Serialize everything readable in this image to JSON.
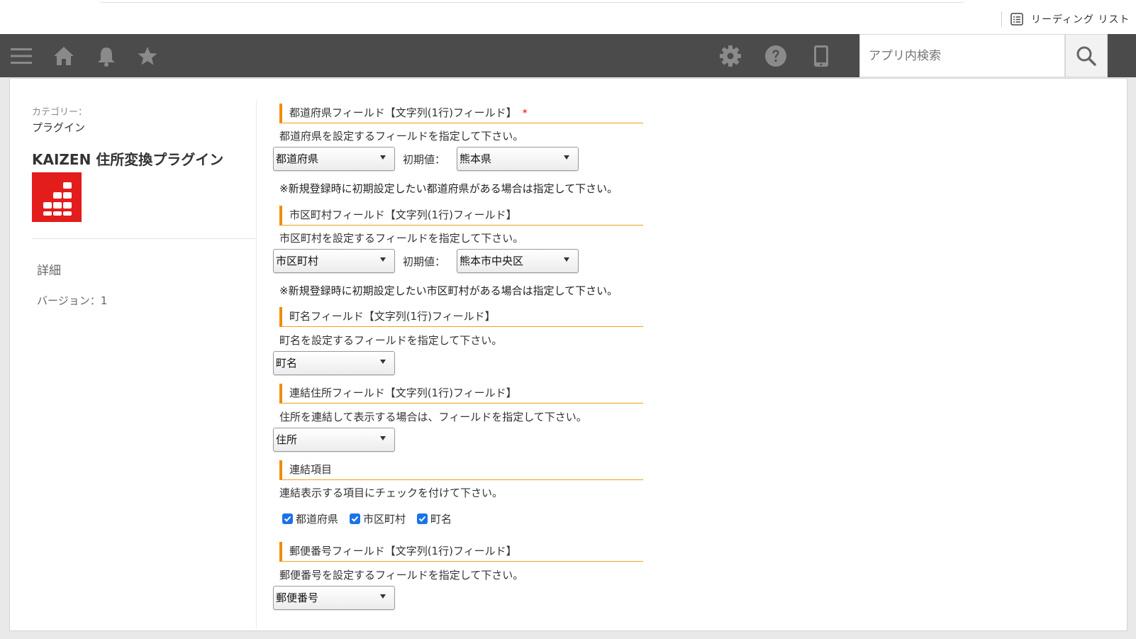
{
  "browser": {
    "reading_list_label": "リーディング リスト"
  },
  "nav": {
    "search_placeholder": "アプリ内検索",
    "icons": [
      "menu-icon",
      "home-icon",
      "bell-icon",
      "star-icon",
      "gear-icon",
      "help-icon",
      "mobile-icon",
      "search-icon"
    ],
    "bar_color": "#4b4b4b"
  },
  "sidebar": {
    "category_label": "カテゴリー：",
    "category_value": "プラグイン",
    "plugin_name": "KAIZEN 住所変換プラグイン",
    "logo_color": "#e31c1c",
    "detail_label": "詳細",
    "version_label": "バージョン：1"
  },
  "form": {
    "accent_color": "#f08c00",
    "prefecture": {
      "title": "都道府県フィールド【文字列(1行)フィールド】",
      "required_mark": "*",
      "desc": "都道府県を設定するフィールドを指定して下さい。",
      "field_value": "都道府県",
      "initial_label": "初期値：",
      "initial_value": "熊本県",
      "note": "※新規登録時に初期設定したい都道府県がある場合は指定して下さい。"
    },
    "city": {
      "title": "市区町村フィールド【文字列(1行)フィールド】",
      "desc": "市区町村を設定するフィールドを指定して下さい。",
      "field_value": "市区町村",
      "initial_label": "初期値：",
      "initial_value": "熊本市中央区",
      "note": "※新規登録時に初期設定したい市区町村がある場合は指定して下さい。"
    },
    "town": {
      "title": "町名フィールド【文字列(1行)フィールド】",
      "desc": "町名を設定するフィールドを指定して下さい。",
      "field_value": "町名"
    },
    "address": {
      "title": "連結住所フィールド【文字列(1行)フィールド】",
      "desc": "住所を連結して表示する場合は、フィールドを指定して下さい。",
      "field_value": "住所"
    },
    "concat_items": {
      "title": "連結項目",
      "desc": "連結表示する項目にチェックを付けて下さい。",
      "checkboxes": [
        {
          "label": "都道府県",
          "checked": true
        },
        {
          "label": "市区町村",
          "checked": true
        },
        {
          "label": "町名",
          "checked": true
        }
      ],
      "check_color": "#1a73e8"
    },
    "postal": {
      "title": "郵便番号フィールド【文字列(1行)フィールド】",
      "desc": "郵便番号を設定するフィールドを指定して下さい。",
      "field_value": "郵便番号"
    }
  }
}
